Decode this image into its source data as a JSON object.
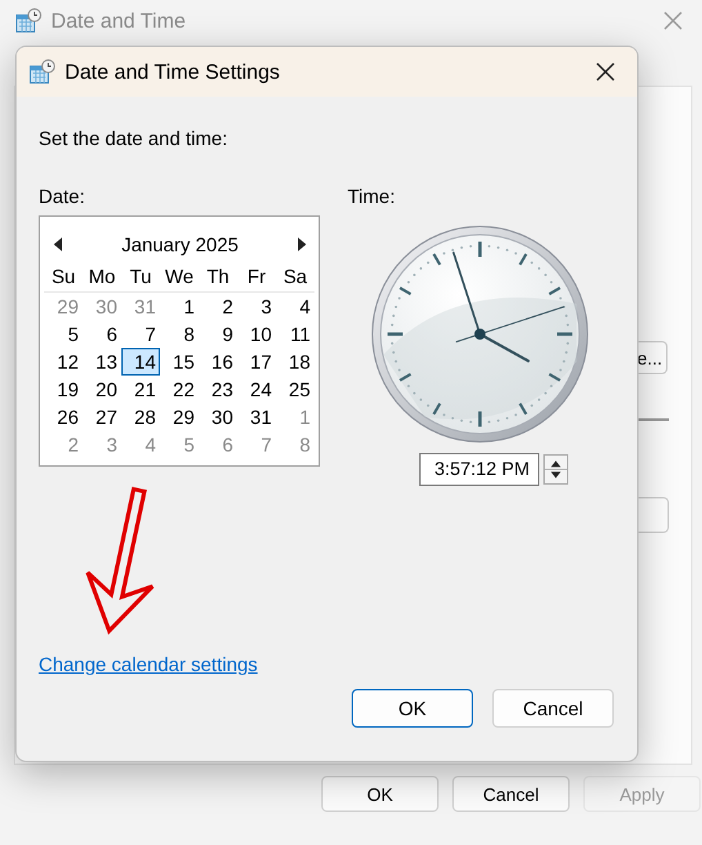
{
  "background_window": {
    "title": "Date and Time",
    "partial_button": "e...",
    "buttons": [
      {
        "label": "OK",
        "disabled": false
      },
      {
        "label": "Cancel",
        "disabled": false
      },
      {
        "label": "Apply",
        "disabled": true
      }
    ]
  },
  "dialog": {
    "title": "Date and Time Settings",
    "prompt": "Set the date and time:",
    "date_label": "Date:",
    "time_label": "Time:",
    "calendar": {
      "month": "January 2025",
      "weekdays": [
        "Su",
        "Mo",
        "Tu",
        "We",
        "Th",
        "Fr",
        "Sa"
      ],
      "days": [
        {
          "day": "29",
          "in_month": false,
          "selected": false
        },
        {
          "day": "30",
          "in_month": false,
          "selected": false
        },
        {
          "day": "31",
          "in_month": false,
          "selected": false
        },
        {
          "day": "1",
          "in_month": true,
          "selected": false
        },
        {
          "day": "2",
          "in_month": true,
          "selected": false
        },
        {
          "day": "3",
          "in_month": true,
          "selected": false
        },
        {
          "day": "4",
          "in_month": true,
          "selected": false
        },
        {
          "day": "5",
          "in_month": true,
          "selected": false
        },
        {
          "day": "6",
          "in_month": true,
          "selected": false
        },
        {
          "day": "7",
          "in_month": true,
          "selected": false
        },
        {
          "day": "8",
          "in_month": true,
          "selected": false
        },
        {
          "day": "9",
          "in_month": true,
          "selected": false
        },
        {
          "day": "10",
          "in_month": true,
          "selected": false
        },
        {
          "day": "11",
          "in_month": true,
          "selected": false
        },
        {
          "day": "12",
          "in_month": true,
          "selected": false
        },
        {
          "day": "13",
          "in_month": true,
          "selected": false
        },
        {
          "day": "14",
          "in_month": true,
          "selected": true
        },
        {
          "day": "15",
          "in_month": true,
          "selected": false
        },
        {
          "day": "16",
          "in_month": true,
          "selected": false
        },
        {
          "day": "17",
          "in_month": true,
          "selected": false
        },
        {
          "day": "18",
          "in_month": true,
          "selected": false
        },
        {
          "day": "19",
          "in_month": true,
          "selected": false
        },
        {
          "day": "20",
          "in_month": true,
          "selected": false
        },
        {
          "day": "21",
          "in_month": true,
          "selected": false
        },
        {
          "day": "22",
          "in_month": true,
          "selected": false
        },
        {
          "day": "23",
          "in_month": true,
          "selected": false
        },
        {
          "day": "24",
          "in_month": true,
          "selected": false
        },
        {
          "day": "25",
          "in_month": true,
          "selected": false
        },
        {
          "day": "26",
          "in_month": true,
          "selected": false
        },
        {
          "day": "27",
          "in_month": true,
          "selected": false
        },
        {
          "day": "28",
          "in_month": true,
          "selected": false
        },
        {
          "day": "29",
          "in_month": true,
          "selected": false
        },
        {
          "day": "30",
          "in_month": true,
          "selected": false
        },
        {
          "day": "31",
          "in_month": true,
          "selected": false
        },
        {
          "day": "1",
          "in_month": false,
          "selected": false
        },
        {
          "day": "2",
          "in_month": false,
          "selected": false
        },
        {
          "day": "3",
          "in_month": false,
          "selected": false
        },
        {
          "day": "4",
          "in_month": false,
          "selected": false
        },
        {
          "day": "5",
          "in_month": false,
          "selected": false
        },
        {
          "day": "6",
          "in_month": false,
          "selected": false
        },
        {
          "day": "7",
          "in_month": false,
          "selected": false
        },
        {
          "day": "8",
          "in_month": false,
          "selected": false
        }
      ]
    },
    "time_value": "3:57:12 PM",
    "link": "Change calendar settings",
    "buttons": [
      {
        "label": "OK",
        "default": true
      },
      {
        "label": "Cancel",
        "default": false
      }
    ]
  }
}
